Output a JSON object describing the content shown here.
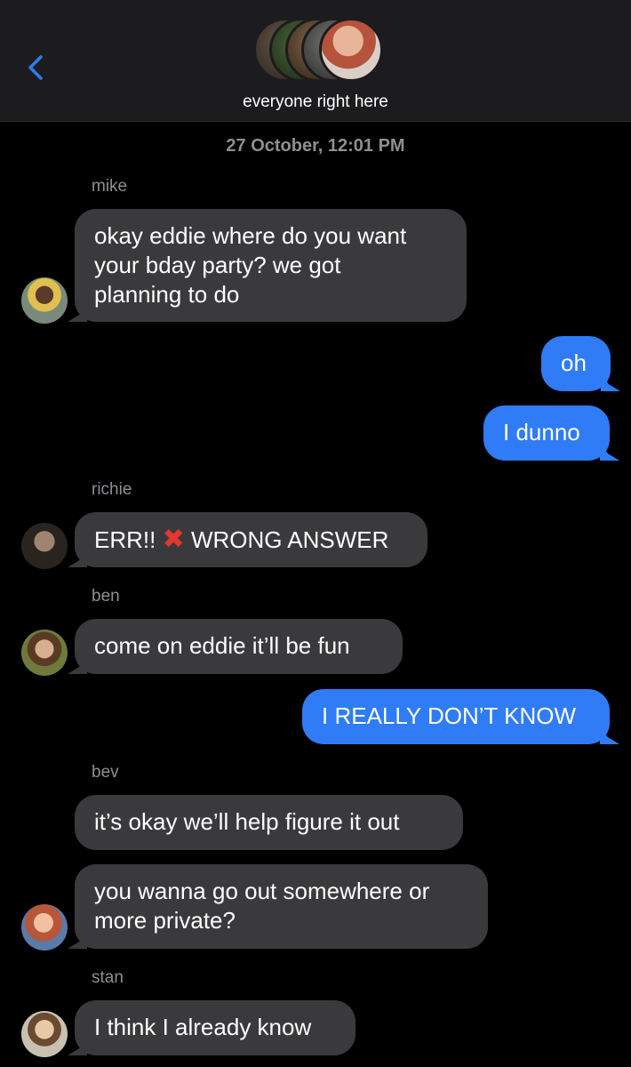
{
  "header": {
    "title": "everyone right here",
    "back_icon": "chevron-left-icon",
    "accent": "#2f7cf6"
  },
  "timestamp": "27 October, 12:01 PM",
  "messages": [
    {
      "sender": "mike",
      "text": "okay eddie where do you want your bday party? we got planning to do",
      "lines": [
        "okay eddie where do you want",
        "your bday party? we got",
        "planning to do"
      ]
    },
    {
      "outgoing": true,
      "text": "oh"
    },
    {
      "outgoing": true,
      "text": "I dunno"
    },
    {
      "sender": "richie",
      "text_before": "ERR!!",
      "emoji": "cross-mark-icon",
      "text_after": "WRONG ANSWER"
    },
    {
      "sender": "ben",
      "text": "come on eddie it’ll be fun"
    },
    {
      "outgoing": true,
      "text": "I REALLY DON’T KNOW"
    },
    {
      "sender": "bev",
      "text": "it’s okay we’ll help figure it out"
    },
    {
      "sender": "bev",
      "text": "you wanna go out somewhere or more private?",
      "lines": [
        "you wanna go out somewhere or",
        "more private?"
      ]
    },
    {
      "sender": "stan",
      "text": "I think I already know"
    }
  ],
  "colors": {
    "incoming_bubble": "#3a3a3c",
    "outgoing_bubble": "#2f7cf6",
    "secondary_text": "#8e8e93",
    "background": "#000000"
  }
}
